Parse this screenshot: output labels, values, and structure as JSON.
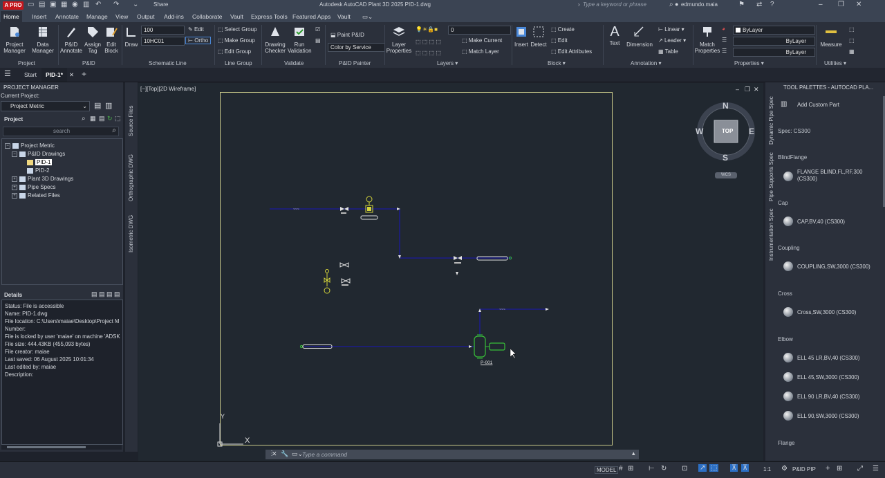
{
  "app": {
    "logo": "A PRO",
    "share": "Share",
    "title": "Autodesk AutoCAD Plant 3D 2025   PID-1.dwg",
    "search_placeholder": "Type a keyword or phrase",
    "user": "edmundo.maia"
  },
  "tabs": [
    "Home",
    "Insert",
    "Annotate",
    "Manage",
    "View",
    "Output",
    "Add-ins",
    "Collaborate",
    "Vault",
    "Express Tools",
    "Featured Apps",
    "Vault"
  ],
  "ribbon": {
    "project_manager": "Project\nManager",
    "data_manager": "Data\nManager",
    "grp_project": "Project",
    "pid_annotate": "P&ID\nAnnotate",
    "assign_tag": "Assign\nTag",
    "edit_block": "Edit\nBlock",
    "grp_pid": "P&ID",
    "draw": "Draw",
    "line_size": "100",
    "line_spec": "10HC01",
    "edit": "Edit",
    "ortho": "Ortho",
    "grp_schematic": "Schematic Line",
    "select_group": "Select Group",
    "make_group": "Make Group",
    "edit_group": "Edit Group",
    "grp_line_group": "Line Group",
    "drawing_checker": "Drawing\nChecker",
    "run_validation": "Run\nValidation",
    "grp_validate": "Validate",
    "paint_pid": "Paint P&ID",
    "color_by_service": "Color by Service",
    "grp_painter": "P&ID Painter",
    "layer_properties": "Layer\nProperties",
    "layer_value": "0",
    "make_current": "Make Current",
    "match_layer": "Match Layer",
    "grp_layers": "Layers",
    "insert": "Insert",
    "detect": "Detect",
    "create": "Create",
    "edit_block2": "Edit",
    "edit_attributes": "Edit Attributes",
    "grp_block": "Block",
    "text": "Text",
    "dimension": "Dimension",
    "linear": "Linear",
    "leader": "Leader",
    "table": "Table",
    "grp_annotation": "Annotation",
    "match_properties": "Match\nProperties",
    "bylayer1": "ByLayer",
    "bylayer2": "ByLayer",
    "bylayer3": "ByLayer",
    "grp_properties": "Properties",
    "measure": "Measure",
    "grp_utilities": "Utilities"
  },
  "filetabs": {
    "start": "Start",
    "active": "PID-1*"
  },
  "project_manager": {
    "title": "PROJECT MANAGER",
    "current_project_label": "Current Project:",
    "current_project": "Project Metric",
    "project_label": "Project",
    "search_placeholder": "search",
    "tree": {
      "root": "Project Metric",
      "pid_drawings": "P&ID Drawings",
      "pid1": "PID-1",
      "pid2": "PID-2",
      "plant3d": "Plant 3D Drawings",
      "pipe_specs": "Pipe Specs",
      "related": "Related Files"
    },
    "details_label": "Details",
    "details": [
      "Status: File is accessible",
      "Name: PID-1.dwg",
      "File location: C:\\Users\\maiae\\Desktop\\Project M",
      "Number:",
      "File is locked by user 'maiae' on machine 'ADSK",
      "File size: 444.43KB (455,093 bytes)",
      "File creator: maiae",
      "Last saved: 06 August 2025 10:01:34",
      "Last edited by: maiae",
      "Description:"
    ]
  },
  "vtabs": [
    "Source Files",
    "Orthographic DWG",
    "Isometric DWG"
  ],
  "viewport": {
    "label": "[−][Top][2D Wireframe]",
    "pump_tag": "P-001",
    "compass": {
      "n": "N",
      "s": "S",
      "e": "E",
      "w": "W",
      "top": "TOP",
      "wcs": "WCS"
    },
    "axis_y": "Y",
    "axis_x": "X"
  },
  "tool_palettes": {
    "title": "TOOL PALETTES - AUTOCAD PLA...",
    "add_custom_part": "Add Custom Part",
    "spec": "Spec: CS300",
    "vtabs": [
      "Dynamic Pipe Spec",
      "Pipe Supports Spec",
      "Instrumentation Spec"
    ],
    "categories": [
      {
        "name": "BlindFlange",
        "items": [
          "FLANGE BLIND,FL,RF,300 (CS300)"
        ]
      },
      {
        "name": "Cap",
        "items": [
          "CAP,BV,40 (CS300)"
        ]
      },
      {
        "name": "Coupling",
        "items": [
          "COUPLING,SW,3000 (CS300)"
        ]
      },
      {
        "name": "Cross",
        "items": [
          "Cross,SW,3000 (CS300)"
        ]
      },
      {
        "name": "Elbow",
        "items": [
          "ELL 45 LR,BV,40 (CS300)",
          "ELL 45,SW,3000 (CS300)",
          "ELL 90 LR,BV,40 (CS300)",
          "ELL 90,SW,3000 (CS300)"
        ]
      },
      {
        "name": "Flange",
        "items": []
      }
    ]
  },
  "command": {
    "placeholder": "Type a command"
  },
  "status": {
    "model": "MODEL",
    "scale": "1:1",
    "workspace": "P&ID PIP"
  },
  "colors": {
    "pipe": "#1c1c8a",
    "selected": "#d4d43a",
    "pump": "#38c038",
    "paper": "#c9c98a"
  }
}
